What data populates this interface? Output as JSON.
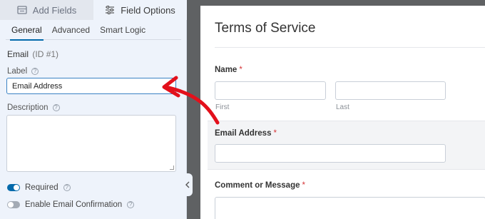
{
  "panel": {
    "tabs": [
      {
        "label": "Add Fields",
        "icon": "table-icon",
        "active": false
      },
      {
        "label": "Field Options",
        "icon": "sliders-icon",
        "active": true
      }
    ],
    "subtabs": [
      "General",
      "Advanced",
      "Smart Logic"
    ],
    "active_subtab": "General",
    "field_name": "Email",
    "field_id": "(ID #1)",
    "label_label": "Label",
    "label_value": "Email Address",
    "description_label": "Description",
    "description_value": "",
    "required_label": "Required",
    "required_on": true,
    "confirmation_label": "Enable Email Confirmation",
    "confirmation_on": false,
    "collapse_icon": "chevron-left-icon"
  },
  "preview": {
    "title": "Terms of Service",
    "name_label": "Name",
    "first_sublabel": "First",
    "last_sublabel": "Last",
    "email_label": "Email Address",
    "comment_label": "Comment or Message",
    "required_mark": "*"
  },
  "colors": {
    "accent": "#036aab",
    "arrow": "#e3101b",
    "required": "#d63638"
  }
}
